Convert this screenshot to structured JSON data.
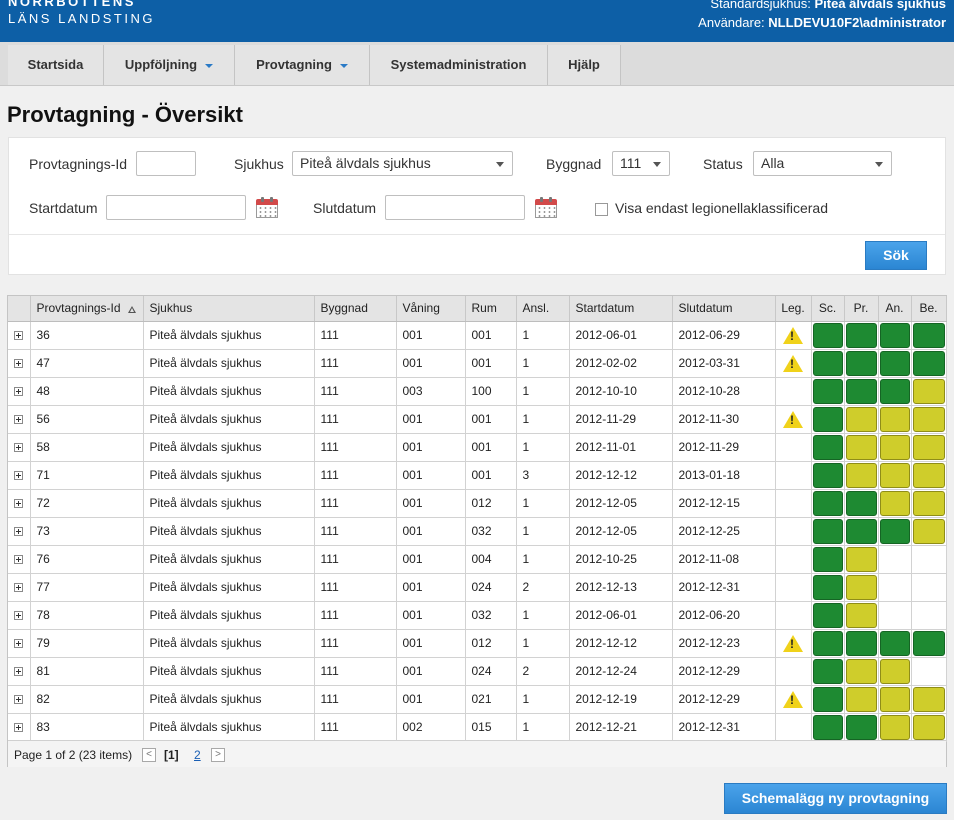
{
  "header": {
    "logo_line1": "NORRBOTTENS",
    "logo_line2": "LÄNS LANDSTING",
    "default_hospital_label": "Standardsjukhus:",
    "default_hospital_value": "Piteå älvdals sjukhus",
    "user_label": "Användare:",
    "user_value": "NLLDEVU10F2\\administrator"
  },
  "nav": {
    "items": [
      {
        "label": "Startsida"
      },
      {
        "label": "Uppföljning"
      },
      {
        "label": "Provtagning"
      },
      {
        "label": "Systemadministration"
      },
      {
        "label": "Hjälp"
      }
    ]
  },
  "page": {
    "title": "Provtagning - Översikt"
  },
  "filters": {
    "id_label": "Provtagnings-Id",
    "id_value": "",
    "hospital_label": "Sjukhus",
    "hospital_value": "Piteå älvdals sjukhus",
    "building_label": "Byggnad",
    "building_value": "111",
    "status_label": "Status",
    "status_value": "Alla",
    "startdate_label": "Startdatum",
    "startdate_value": "",
    "enddate_label": "Slutdatum",
    "enddate_value": "",
    "legionella_label": "Visa endast legionellaklassificerad",
    "search_button": "Sök"
  },
  "grid": {
    "columns": [
      "Provtagnings-Id",
      "Sjukhus",
      "Byggnad",
      "Våning",
      "Rum",
      "Ansl.",
      "Startdatum",
      "Slutdatum",
      "Leg.",
      "Sc.",
      "Pr.",
      "An.",
      "Be."
    ],
    "rows": [
      {
        "id": "36",
        "sjukhus": "Piteå älvdals sjukhus",
        "byggnad": "111",
        "vaning": "001",
        "rum": "001",
        "ansl": "1",
        "start": "2012-06-01",
        "slut": "2012-06-29",
        "leg": true,
        "status": [
          "green",
          "green",
          "green",
          "green"
        ]
      },
      {
        "id": "47",
        "sjukhus": "Piteå älvdals sjukhus",
        "byggnad": "111",
        "vaning": "001",
        "rum": "001",
        "ansl": "1",
        "start": "2012-02-02",
        "slut": "2012-03-31",
        "leg": true,
        "status": [
          "green",
          "green",
          "green",
          "green"
        ]
      },
      {
        "id": "48",
        "sjukhus": "Piteå älvdals sjukhus",
        "byggnad": "111",
        "vaning": "003",
        "rum": "100",
        "ansl": "1",
        "start": "2012-10-10",
        "slut": "2012-10-28",
        "leg": false,
        "status": [
          "green",
          "green",
          "green",
          "yellow"
        ]
      },
      {
        "id": "56",
        "sjukhus": "Piteå älvdals sjukhus",
        "byggnad": "111",
        "vaning": "001",
        "rum": "001",
        "ansl": "1",
        "start": "2012-11-29",
        "slut": "2012-11-30",
        "leg": true,
        "status": [
          "green",
          "yellow",
          "yellow",
          "yellow"
        ]
      },
      {
        "id": "58",
        "sjukhus": "Piteå älvdals sjukhus",
        "byggnad": "111",
        "vaning": "001",
        "rum": "001",
        "ansl": "1",
        "start": "2012-11-01",
        "slut": "2012-11-29",
        "leg": false,
        "status": [
          "green",
          "yellow",
          "yellow",
          "yellow"
        ]
      },
      {
        "id": "71",
        "sjukhus": "Piteå älvdals sjukhus",
        "byggnad": "111",
        "vaning": "001",
        "rum": "001",
        "ansl": "3",
        "start": "2012-12-12",
        "slut": "2013-01-18",
        "leg": false,
        "status": [
          "green",
          "yellow",
          "yellow",
          "yellow"
        ]
      },
      {
        "id": "72",
        "sjukhus": "Piteå älvdals sjukhus",
        "byggnad": "111",
        "vaning": "001",
        "rum": "012",
        "ansl": "1",
        "start": "2012-12-05",
        "slut": "2012-12-15",
        "leg": false,
        "status": [
          "green",
          "green",
          "yellow",
          "yellow"
        ]
      },
      {
        "id": "73",
        "sjukhus": "Piteå älvdals sjukhus",
        "byggnad": "111",
        "vaning": "001",
        "rum": "032",
        "ansl": "1",
        "start": "2012-12-05",
        "slut": "2012-12-25",
        "leg": false,
        "status": [
          "green",
          "green",
          "green",
          "yellow"
        ]
      },
      {
        "id": "76",
        "sjukhus": "Piteå älvdals sjukhus",
        "byggnad": "111",
        "vaning": "001",
        "rum": "004",
        "ansl": "1",
        "start": "2012-10-25",
        "slut": "2012-11-08",
        "leg": false,
        "status": [
          "green",
          "yellow",
          "",
          ""
        ]
      },
      {
        "id": "77",
        "sjukhus": "Piteå älvdals sjukhus",
        "byggnad": "111",
        "vaning": "001",
        "rum": "024",
        "ansl": "2",
        "start": "2012-12-13",
        "slut": "2012-12-31",
        "leg": false,
        "status": [
          "green",
          "yellow",
          "",
          ""
        ]
      },
      {
        "id": "78",
        "sjukhus": "Piteå älvdals sjukhus",
        "byggnad": "111",
        "vaning": "001",
        "rum": "032",
        "ansl": "1",
        "start": "2012-06-01",
        "slut": "2012-06-20",
        "leg": false,
        "status": [
          "green",
          "yellow",
          "",
          ""
        ]
      },
      {
        "id": "79",
        "sjukhus": "Piteå älvdals sjukhus",
        "byggnad": "111",
        "vaning": "001",
        "rum": "012",
        "ansl": "1",
        "start": "2012-12-12",
        "slut": "2012-12-23",
        "leg": true,
        "status": [
          "green",
          "green",
          "green",
          "green"
        ]
      },
      {
        "id": "81",
        "sjukhus": "Piteå älvdals sjukhus",
        "byggnad": "111",
        "vaning": "001",
        "rum": "024",
        "ansl": "2",
        "start": "2012-12-24",
        "slut": "2012-12-29",
        "leg": false,
        "status": [
          "green",
          "yellow",
          "yellow",
          ""
        ]
      },
      {
        "id": "82",
        "sjukhus": "Piteå älvdals sjukhus",
        "byggnad": "111",
        "vaning": "001",
        "rum": "021",
        "ansl": "1",
        "start": "2012-12-19",
        "slut": "2012-12-29",
        "leg": true,
        "status": [
          "green",
          "yellow",
          "yellow",
          "yellow"
        ]
      },
      {
        "id": "83",
        "sjukhus": "Piteå älvdals sjukhus",
        "byggnad": "111",
        "vaning": "002",
        "rum": "015",
        "ansl": "1",
        "start": "2012-12-21",
        "slut": "2012-12-31",
        "leg": false,
        "status": [
          "green",
          "green",
          "yellow",
          "yellow"
        ]
      }
    ]
  },
  "pager": {
    "info": "Page 1 of 2 (23 items)",
    "current": "[1]",
    "next_page": "2",
    "prev_icon": "<",
    "next_icon": ">"
  },
  "actions": {
    "schedule_button": "Schemalägg ny provtagning"
  },
  "colors": {
    "header_blue": "#0d5fa6",
    "status_green": "#1e8a32",
    "status_yellow": "#cfcd2b",
    "warning": "#f0d21a"
  }
}
